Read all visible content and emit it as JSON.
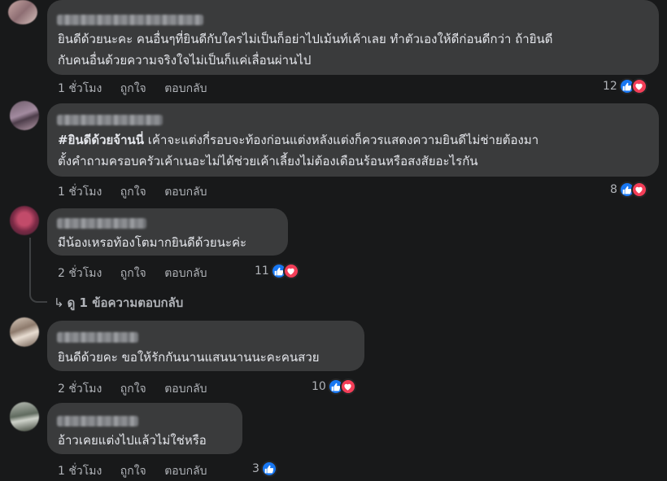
{
  "comments": [
    {
      "id": "c1",
      "text_lines": [
        "ยินดีด้วยนะคะ คนอื่นๆที่ยินดีกับใครไม่เป็นก็อย่าไปเม้นท์เค้าเลย ทำตัวเองให้ดีก่อนดีกว่า ถ้ายินดี",
        "กับคนอื่นด้วยความจริงใจไม่เป็นก็แค่เลื่อนผ่านไป"
      ],
      "time": "1 ชั่วโมง",
      "like_label": "ถูกใจ",
      "reply_label": "ตอบกลับ",
      "reaction_count": "12"
    },
    {
      "id": "c2",
      "text_lines": [
        "#ยินดีด้วยจ้านนี่ เค้าจะแต่งกี่รอบจะท้องก่อนแต่งหลังแต่งก็ควรแสดงความยินดีไม่ช่ายต้องมา",
        "ตั้งคำถามครอบครัวเค้าเนอะไม่ได้ช่วยเค้าเลี้ยงไม่ต้องเดือนร้อนหรือสงสัยอะไรกัน"
      ],
      "hashtag": "#ยินดีด้วยจ้านนี่",
      "text_rest": " เค้าจะแต่งกี่รอบจะท้องก่อนแต่งหลังแต่งก็ควรแสดงความยินดีไม่ช่ายต้องมา",
      "time": "1 ชั่วโมง",
      "like_label": "ถูกใจ",
      "reply_label": "ตอบกลับ",
      "reaction_count": "8"
    },
    {
      "id": "c3",
      "text_lines": [
        "มีน้องเหรอท้องโตมากยินดีด้วยนะค่ะ"
      ],
      "time": "2 ชั่วโมง",
      "like_label": "ถูกใจ",
      "reply_label": "ตอบกลับ",
      "reaction_count": "11",
      "view_replies": "ดู 1 ข้อความตอบกลับ"
    },
    {
      "id": "c4",
      "text_lines": [
        "ยินดีด้วยคะ ขอให้รักกันนานแสนนานนะคะคนสวย"
      ],
      "time": "2 ชั่วโมง",
      "like_label": "ถูกใจ",
      "reply_label": "ตอบกลับ",
      "reaction_count": "10"
    },
    {
      "id": "c5",
      "text_lines": [
        "อ้าวเคยแต่งไปแล้วไม่ใช่หรือ"
      ],
      "time": "1 ชั่วโมง",
      "like_label": "ถูกใจ",
      "reply_label": "ตอบกลับ",
      "reaction_count": "3"
    }
  ],
  "colors": {
    "background": "#18191a",
    "bubble": "#3a3b3c",
    "text": "#e4e6eb",
    "secondary_text": "#b0b3b8",
    "like_blue": "#1877f2",
    "love_red": "#f33e58"
  },
  "icons": [
    "like-icon",
    "love-icon",
    "reply-arrow-icon"
  ]
}
